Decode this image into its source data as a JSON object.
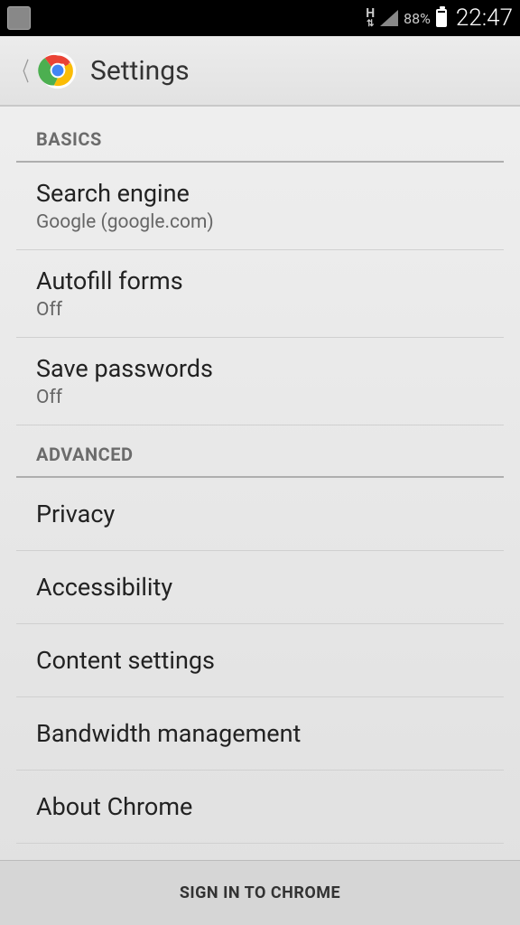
{
  "status": {
    "network_label": "H",
    "battery_pct": "88%",
    "time": "22:47"
  },
  "header": {
    "title": "Settings"
  },
  "sections": {
    "basics": {
      "label": "BASICS",
      "items": {
        "search_engine": {
          "title": "Search engine",
          "subtitle": "Google (google.com)"
        },
        "autofill": {
          "title": "Autofill forms",
          "subtitle": "Off"
        },
        "save_passwords": {
          "title": "Save passwords",
          "subtitle": "Off"
        }
      }
    },
    "advanced": {
      "label": "ADVANCED",
      "items": {
        "privacy": {
          "title": "Privacy"
        },
        "accessibility": {
          "title": "Accessibility"
        },
        "content": {
          "title": "Content settings"
        },
        "bandwidth": {
          "title": "Bandwidth management"
        },
        "about": {
          "title": "About Chrome"
        }
      }
    }
  },
  "footer": {
    "signin_label": "SIGN IN TO CHROME"
  }
}
